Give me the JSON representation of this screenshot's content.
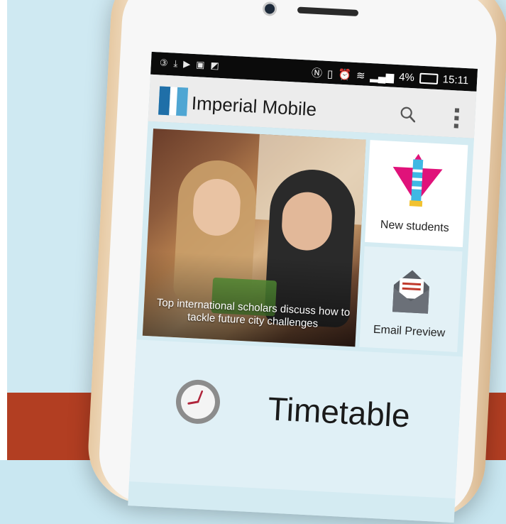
{
  "status_bar": {
    "left_icons": [
      "notification-3-icon",
      "download-icon",
      "play-store-icon",
      "gallery-icon",
      "photo-icon"
    ],
    "right_icons": [
      "nfc-icon",
      "vibrate-icon",
      "alarm-icon",
      "wifi-icon",
      "signal-icon"
    ],
    "battery_percent": "4%",
    "time": "15:11"
  },
  "app_bar": {
    "title": "Imperial Mobile",
    "icons": [
      "search-icon",
      "overflow-menu-icon"
    ]
  },
  "news": {
    "caption": "Top international scholars discuss how to tackle future city challenges"
  },
  "tiles": {
    "new_students": {
      "label": "New students",
      "icon": "lighthouse-icon"
    },
    "email_preview": {
      "label": "Email Preview",
      "icon": "envelope-icon"
    }
  },
  "timetable": {
    "label": "Timetable",
    "icon": "clock-icon"
  },
  "colors": {
    "background_top": "#cfe9f2",
    "background_bottom": "#b23e22",
    "brand_blue": "#1f6fa8",
    "status_bar": "#0b0b0b"
  }
}
